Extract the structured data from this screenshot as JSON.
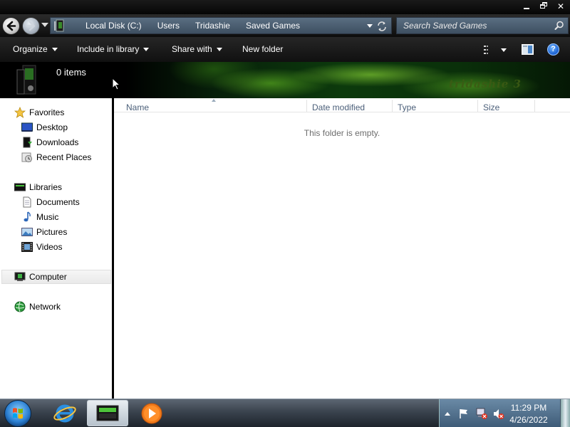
{
  "window": {
    "min_icon": "minimize-icon",
    "max_icon": "restore-icon",
    "close_symbol": "✕"
  },
  "navigation": {
    "back_icon": "back-arrow-icon",
    "forward_icon": "forward-arrow-icon",
    "breadcrumbs": [
      "Local Disk (C:)",
      "Users",
      "Tridashie",
      "Saved Games"
    ],
    "search_placeholder": "Search Saved Games"
  },
  "toolbar": {
    "organize": "Organize",
    "include_in_library": "Include in library",
    "share_with": "Share with",
    "new_folder": "New folder",
    "help": "?"
  },
  "details": {
    "item_count": "0 items",
    "watermark": "tridashie 3"
  },
  "sidebar": {
    "favorites": {
      "label": "Favorites",
      "items": [
        "Desktop",
        "Downloads",
        "Recent Places"
      ]
    },
    "libraries": {
      "label": "Libraries",
      "items": [
        "Documents",
        "Music",
        "Pictures",
        "Videos"
      ]
    },
    "computer": "Computer",
    "network": "Network"
  },
  "columns": [
    "Name",
    "Date modified",
    "Type",
    "Size"
  ],
  "content": {
    "empty_message": "This folder is empty."
  },
  "taskbar": {
    "pinned": [
      "Internet Explorer",
      "Windows Explorer",
      "Windows Media Player"
    ],
    "clock": {
      "time": "11:29 PM",
      "date": "4/26/2022"
    }
  },
  "colors": {
    "accent_green": "#5fd21e",
    "link_blue": "#4c607a"
  }
}
